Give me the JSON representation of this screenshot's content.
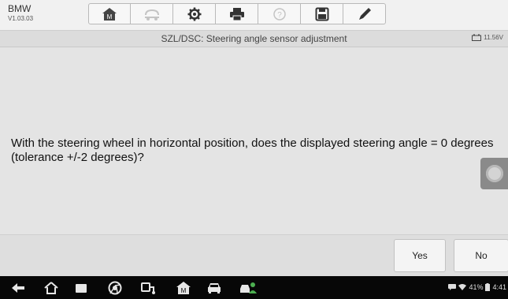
{
  "app": {
    "name": "BMW",
    "version": "V1.03.03"
  },
  "toolbar": {
    "buttons": [
      {
        "icon": "home-icon",
        "enabled": true
      },
      {
        "icon": "vehicle-swap-icon",
        "enabled": false
      },
      {
        "icon": "settings-gear-icon",
        "enabled": true
      },
      {
        "icon": "printer-icon",
        "enabled": true
      },
      {
        "icon": "help-icon",
        "enabled": false
      },
      {
        "icon": "save-icon",
        "enabled": true
      },
      {
        "icon": "pen-icon",
        "enabled": true
      }
    ]
  },
  "screen": {
    "title": "SZL/DSC: Steering angle sensor adjustment",
    "battery_voltage": "11.56V"
  },
  "message": "With the steering wheel in horizontal position, does the displayed steering angle = 0 degrees (tolerance +/-2 degrees)?",
  "actions": {
    "yes_label": "Yes",
    "no_label": "No"
  },
  "status_bar": {
    "battery_percent": "41%",
    "time": "4:41"
  },
  "colors": {
    "background": "#e4e4e4",
    "navbar": "#070707",
    "icon": "#333333"
  }
}
